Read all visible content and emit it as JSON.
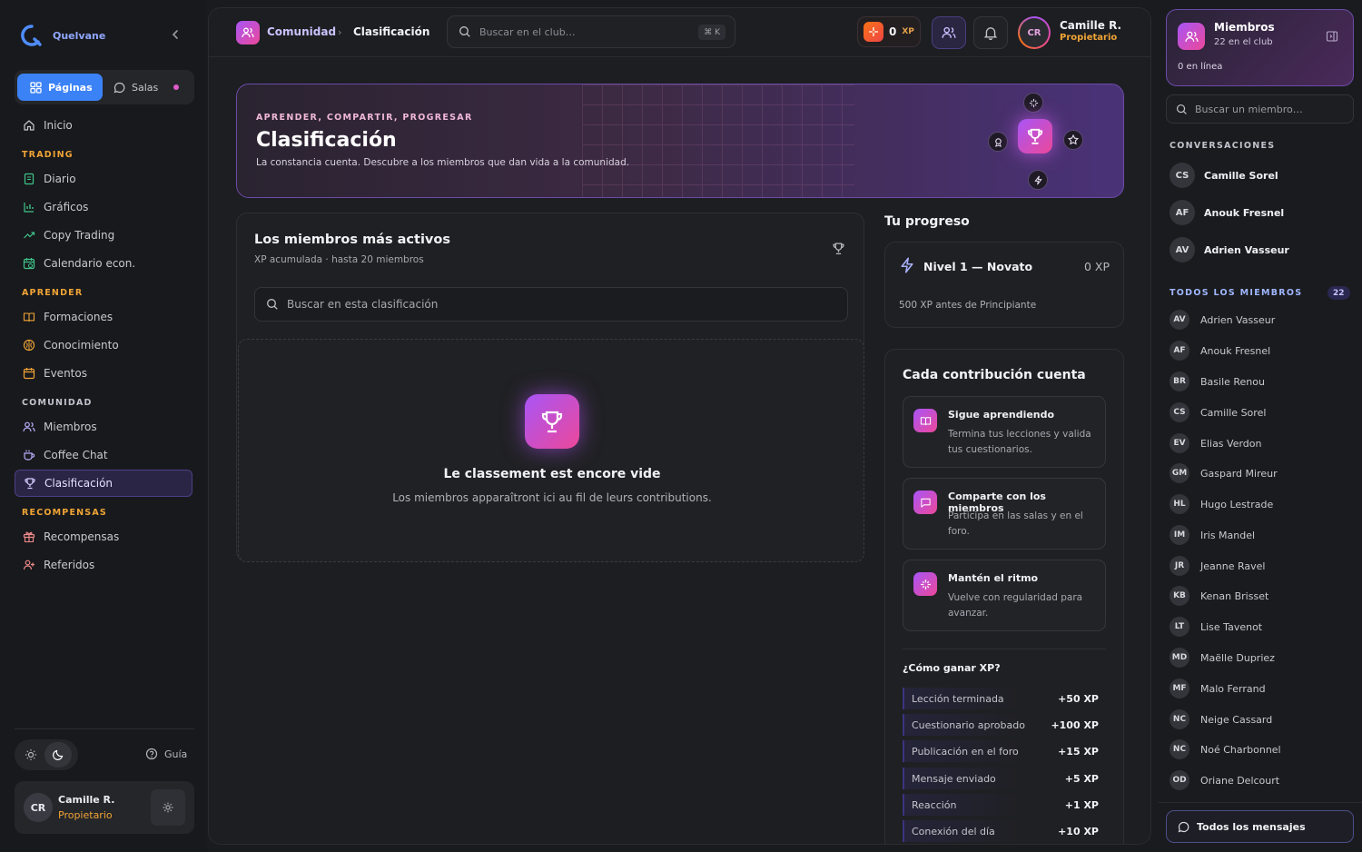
{
  "brand": {
    "name": "Quelvane"
  },
  "sidebar": {
    "toggle": {
      "pages": "Páginas",
      "rooms": "Salas"
    },
    "home": "Inicio",
    "sections": {
      "trading": "TRADING",
      "learn": "APRENDER",
      "community": "COMUNIDAD",
      "rewards": "RECOMPENSAS"
    },
    "trading_items": [
      "Diario",
      "Gráficos",
      "Copy Trading",
      "Calendario econ."
    ],
    "learn_items": [
      "Formaciones",
      "Conocimiento",
      "Eventos"
    ],
    "community_items": [
      "Miembros",
      "Coffee Chat",
      "Clasificación"
    ],
    "rewards_items": [
      "Recompensas",
      "Referidos"
    ],
    "guide": "Guía",
    "user": {
      "initials": "CR",
      "name": "Camille R.",
      "role": "Propietario"
    }
  },
  "topbar": {
    "breadcrumb": [
      "Comunidad",
      "Clasificación"
    ],
    "search_placeholder": "Buscar en el club…",
    "shortcut": "⌘ K",
    "xp_value": "0",
    "xp_unit": "XP",
    "user": {
      "initials": "CR",
      "name": "Camille R.",
      "role": "Propietario"
    }
  },
  "hero": {
    "eyebrow": "APRENDER, COMPARTIR, PROGRESAR",
    "title": "Clasificación",
    "subtitle": "La constancia cuenta. Descubre a los miembros que dan vida a la comunidad."
  },
  "leaderboard": {
    "title": "Los miembros más activos",
    "subtitle": "XP acumulada · hasta 20 miembros",
    "search_placeholder": "Buscar en esta clasificación",
    "empty_title": "Le classement est encore vide",
    "empty_subtitle": "Los miembros apparaîtront ici au fil de leurs contributions."
  },
  "progress": {
    "heading": "Tu progreso",
    "level": "Nivel 1 — Novato",
    "xp": "0 XP",
    "note": "500 XP antes de Principiante"
  },
  "contributions": {
    "heading": "Cada contribución cuenta",
    "items": [
      {
        "title": "Sigue aprendiendo",
        "desc": "Termina tus lecciones y valida tus cuestionarios."
      },
      {
        "title": "Comparte con los miembros",
        "desc": "Participa en las salas y en el foro."
      },
      {
        "title": "Mantén el ritmo",
        "desc": "Vuelve con regularidad para avanzar."
      }
    ],
    "earn_heading": "¿Cómo ganar XP?",
    "earn": [
      {
        "label": "Lección terminada",
        "xp": "+50 XP"
      },
      {
        "label": "Cuestionario aprobado",
        "xp": "+100 XP"
      },
      {
        "label": "Publicación en el foro",
        "xp": "+15 XP"
      },
      {
        "label": "Mensaje enviado",
        "xp": "+5 XP"
      },
      {
        "label": "Reacción",
        "xp": "+1 XP"
      },
      {
        "label": "Conexión del día",
        "xp": "+10 XP"
      }
    ]
  },
  "members_panel": {
    "title": "Miembros",
    "subtitle": "22 en el club",
    "online": "0 en línea",
    "search_placeholder": "Buscar un miembro…",
    "conversations_heading": "CONVERSACIONES",
    "conversations": [
      {
        "initials": "CS",
        "name": "Camille Sorel"
      },
      {
        "initials": "AF",
        "name": "Anouk Fresnel"
      },
      {
        "initials": "AV",
        "name": "Adrien Vasseur"
      }
    ],
    "all_heading": "TODOS LOS MIEMBROS",
    "count": "22",
    "members": [
      {
        "initials": "AV",
        "name": "Adrien Vasseur"
      },
      {
        "initials": "AF",
        "name": "Anouk Fresnel"
      },
      {
        "initials": "BR",
        "name": "Basile Renou"
      },
      {
        "initials": "CS",
        "name": "Camille Sorel"
      },
      {
        "initials": "EV",
        "name": "Elias Verdon"
      },
      {
        "initials": "GM",
        "name": "Gaspard Mireur"
      },
      {
        "initials": "HL",
        "name": "Hugo Lestrade"
      },
      {
        "initials": "IM",
        "name": "Iris Mandel"
      },
      {
        "initials": "JR",
        "name": "Jeanne Ravel"
      },
      {
        "initials": "KB",
        "name": "Kenan Brisset"
      },
      {
        "initials": "LT",
        "name": "Lise Tavenot"
      },
      {
        "initials": "MD",
        "name": "Maëlle Dupriez"
      },
      {
        "initials": "MF",
        "name": "Malo Ferrand"
      },
      {
        "initials": "NC",
        "name": "Neige Cassard"
      },
      {
        "initials": "NC",
        "name": "Noé Charbonnel"
      },
      {
        "initials": "OD",
        "name": "Oriane Delcourt"
      }
    ],
    "all_messages": "Todos los mensajes"
  },
  "colors": {
    "accent": "#3b82f6",
    "brand_gradient_start": "#a855f7",
    "brand_gradient_end": "#ec4899",
    "section_orange": "#f0a436"
  }
}
